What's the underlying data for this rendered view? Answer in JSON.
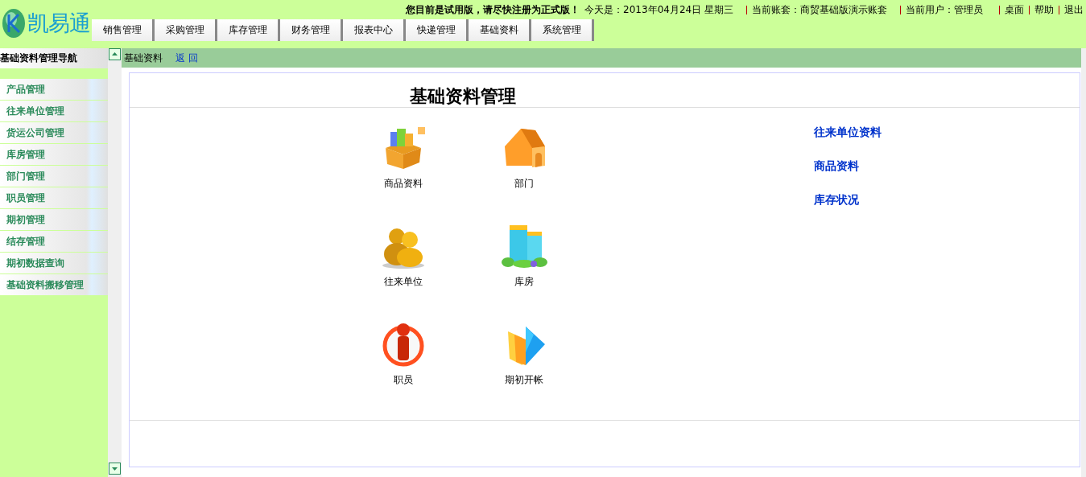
{
  "logo": {
    "text": "凯易通"
  },
  "top_bar": {
    "notice": "您目前是试用版，请尽快注册为正式版！",
    "date": "今天是：2013年04月24日  星期三",
    "account": "当前账套：商贸基础版演示账套",
    "user": "当前用户：管理员",
    "links": [
      "桌面",
      "帮助",
      "退出"
    ]
  },
  "tabs": [
    "销售管理",
    "采购管理",
    "库存管理",
    "财务管理",
    "报表中心",
    "快递管理",
    "基础资料",
    "系统管理"
  ],
  "sidebar": {
    "title": "基础资料管理导航",
    "items": [
      "产品管理",
      "往来单位管理",
      "货运公司管理",
      "库房管理",
      "部门管理",
      "职员管理",
      "期初管理",
      "结存管理",
      "期初数据查询",
      "基础资料搬移管理"
    ]
  },
  "breadcrumb": {
    "current": "基础资料",
    "back_link": "返 回"
  },
  "content": {
    "title": "基础资料管理",
    "modules": [
      {
        "label": "商品资料",
        "kind": "box"
      },
      {
        "label": "部门",
        "kind": "house"
      },
      {
        "label": "往来单位",
        "kind": "people"
      },
      {
        "label": "库房",
        "kind": "buildings"
      },
      {
        "label": "职员",
        "kind": "person"
      },
      {
        "label": "期初开帐",
        "kind": "folder"
      }
    ],
    "quick_links": [
      "往来单位资料",
      "商品资料",
      "库存状况"
    ]
  }
}
